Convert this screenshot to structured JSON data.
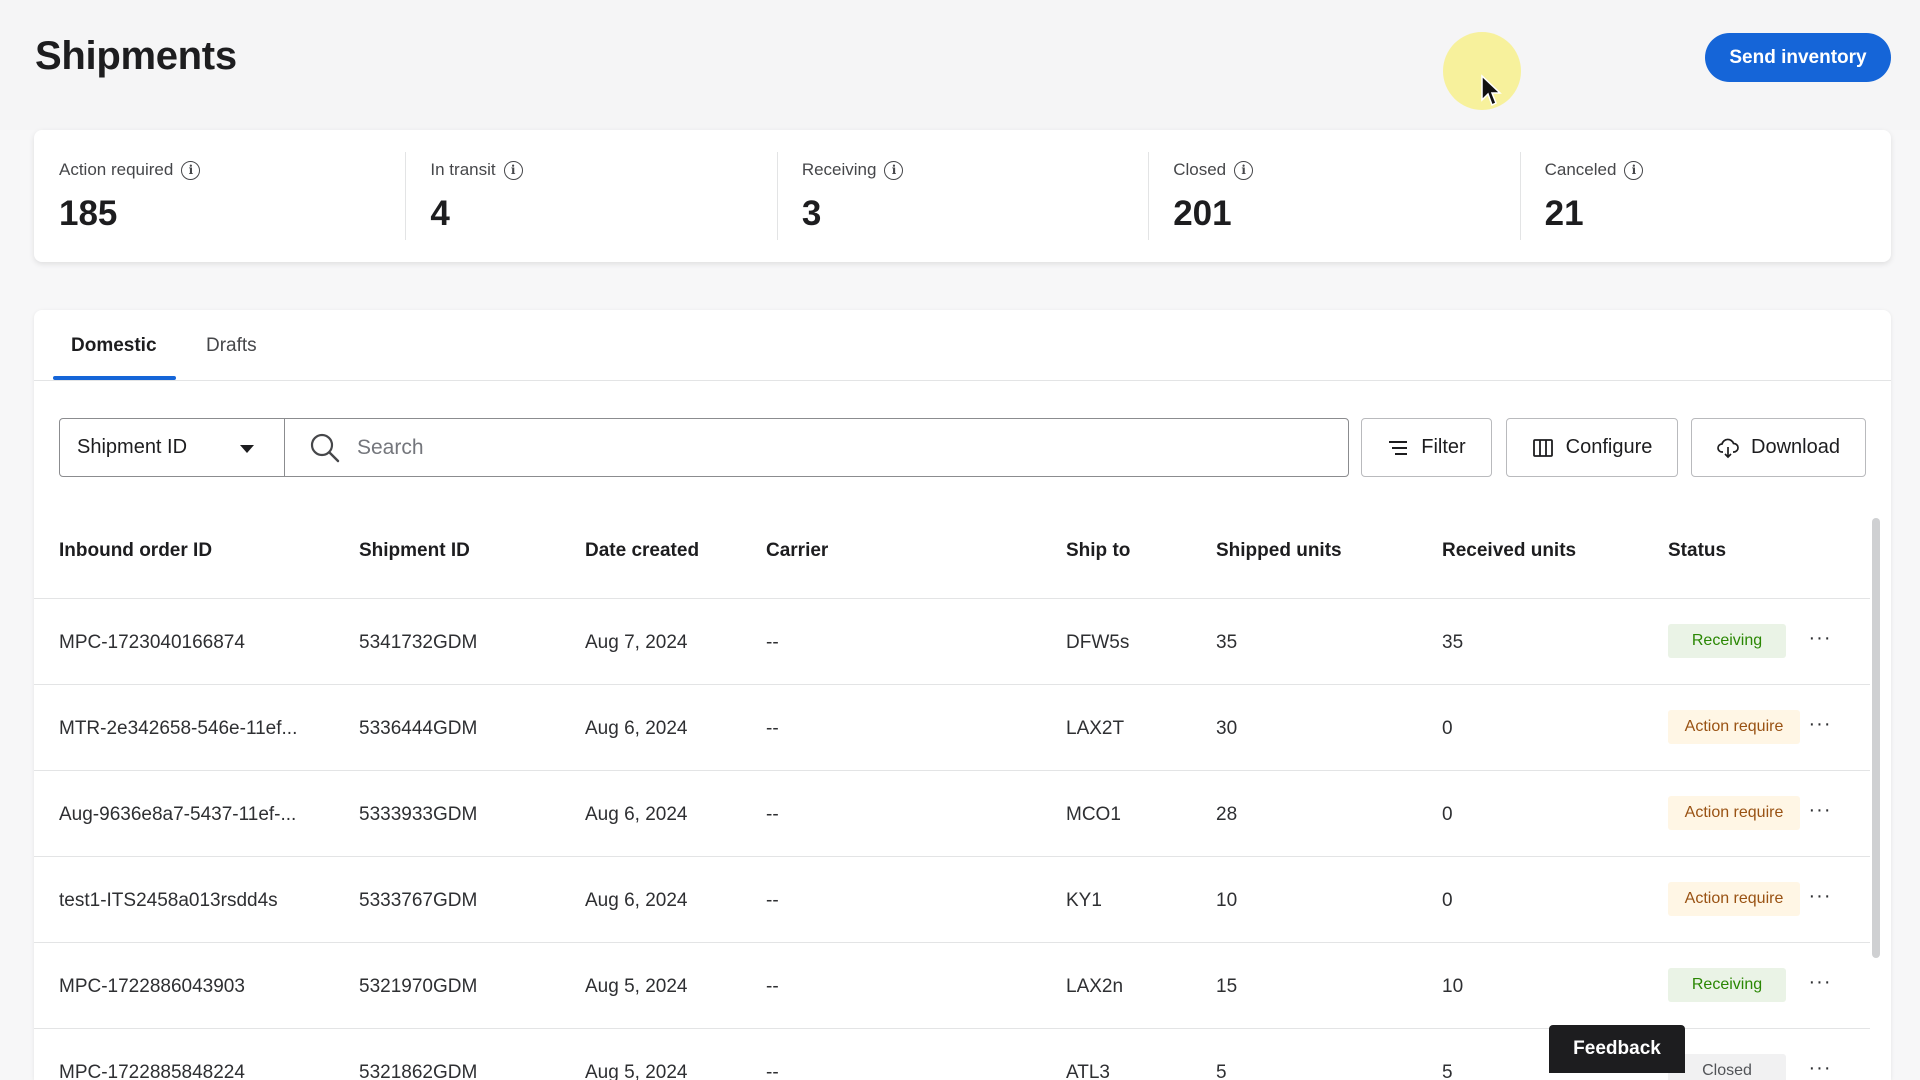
{
  "header": {
    "title": "Shipments",
    "send_inventory_label": "Send inventory"
  },
  "stats": [
    {
      "label": "Action required",
      "value": "185"
    },
    {
      "label": "In transit",
      "value": "4"
    },
    {
      "label": "Receiving",
      "value": "3"
    },
    {
      "label": "Closed",
      "value": "201"
    },
    {
      "label": "Canceled",
      "value": "21"
    }
  ],
  "tabs": [
    {
      "label": "Domestic",
      "active": true
    },
    {
      "label": "Drafts",
      "active": false
    }
  ],
  "toolbar": {
    "field_select_value": "Shipment ID",
    "search_placeholder": "Search",
    "filter_label": "Filter",
    "configure_label": "Configure",
    "download_label": "Download"
  },
  "table": {
    "columns": [
      "Inbound order ID",
      "Shipment ID",
      "Date created",
      "Carrier",
      "Ship to",
      "Shipped units",
      "Received units",
      "Status"
    ],
    "rows": [
      {
        "inbound_order_id": "MPC-1723040166874",
        "shipment_id": "5341732GDM",
        "date_created": "Aug 7, 2024",
        "carrier": "--",
        "ship_to": "DFW5s",
        "shipped_units": "35",
        "received_units": "35",
        "status": "Receiving"
      },
      {
        "inbound_order_id": "MTR-2e342658-546e-11ef...",
        "shipment_id": "5336444GDM",
        "date_created": "Aug 6, 2024",
        "carrier": "--",
        "ship_to": "LAX2T",
        "shipped_units": "30",
        "received_units": "0",
        "status": "Action require"
      },
      {
        "inbound_order_id": "Aug-9636e8a7-5437-11ef-...",
        "shipment_id": "5333933GDM",
        "date_created": "Aug 6, 2024",
        "carrier": "--",
        "ship_to": "MCO1",
        "shipped_units": "28",
        "received_units": "0",
        "status": "Action require"
      },
      {
        "inbound_order_id": "test1-ITS2458a013rsdd4s",
        "shipment_id": "5333767GDM",
        "date_created": "Aug 6, 2024",
        "carrier": "--",
        "ship_to": "KY1",
        "shipped_units": "10",
        "received_units": "0",
        "status": "Action require"
      },
      {
        "inbound_order_id": "MPC-1722886043903",
        "shipment_id": "5321970GDM",
        "date_created": "Aug 5, 2024",
        "carrier": "--",
        "ship_to": "LAX2n",
        "shipped_units": "15",
        "received_units": "10",
        "status": "Receiving"
      },
      {
        "inbound_order_id": "MPC-1722885848224",
        "shipment_id": "5321862GDM",
        "date_created": "Aug 5, 2024",
        "carrier": "--",
        "ship_to": "ATL3",
        "shipped_units": "5",
        "received_units": "5",
        "status": "Closed"
      }
    ],
    "more_label": "···"
  },
  "feedback_label": "Feedback",
  "colors": {
    "accent": "#1565d8",
    "receiving": "#2a8703",
    "action_required": "#995213",
    "closed": "#515357"
  },
  "icons": [
    "info-icon",
    "caret-down-icon",
    "search-icon",
    "filter-icon",
    "columns-icon",
    "cloud-download-icon",
    "more-icon",
    "cursor-icon"
  ]
}
